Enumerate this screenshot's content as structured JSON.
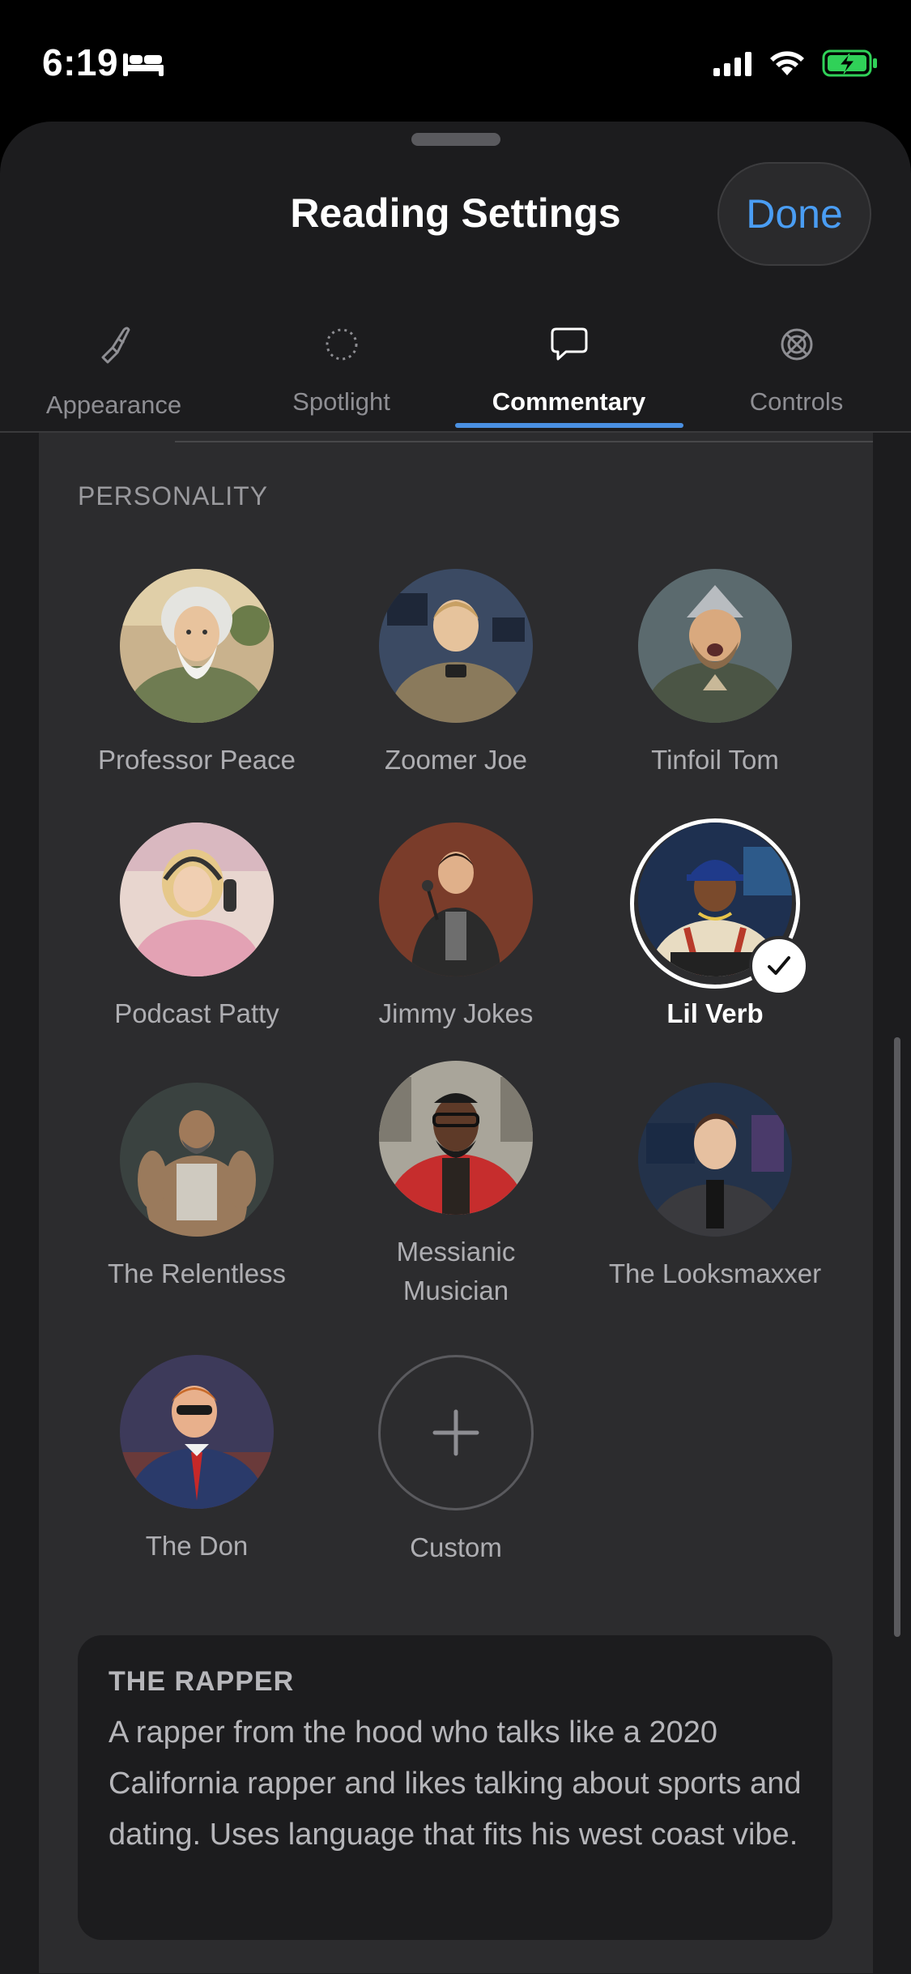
{
  "status_bar": {
    "time": "6:19",
    "icons": [
      "bed-icon",
      "cellular-signal-icon",
      "wifi-icon",
      "battery-charging-icon"
    ],
    "battery_color": "#30d158"
  },
  "sheet": {
    "title": "Reading Settings",
    "done_label": "Done",
    "accent_color": "#4a9df3"
  },
  "tabs": [
    {
      "label": "Appearance",
      "icon": "paintbrush-icon",
      "active": false
    },
    {
      "label": "Spotlight",
      "icon": "dotted-circle-icon",
      "active": false
    },
    {
      "label": "Commentary",
      "icon": "speech-bubble-icon",
      "active": true
    },
    {
      "label": "Controls",
      "icon": "crossed-circle-icon",
      "active": false
    }
  ],
  "personality": {
    "section_label": "PERSONALITY",
    "personas": [
      {
        "name": "Professor Peace",
        "icon": "wise-elder-avatar",
        "selected": false
      },
      {
        "name": "Zoomer Joe",
        "icon": "gamer-avatar",
        "selected": false
      },
      {
        "name": "Tinfoil Tom",
        "icon": "conspiracy-avatar",
        "selected": false
      },
      {
        "name": "Podcast Patty",
        "icon": "podcaster-avatar",
        "selected": false
      },
      {
        "name": "Jimmy Jokes",
        "icon": "comedian-avatar",
        "selected": false
      },
      {
        "name": "Lil Verb",
        "icon": "rapper-avatar",
        "selected": true
      },
      {
        "name": "The Relentless",
        "icon": "bodybuilder-avatar",
        "selected": false
      },
      {
        "name": "Messianic Musician",
        "icon": "musician-avatar",
        "selected": false
      },
      {
        "name": "The Looksmaxxer",
        "icon": "looksmaxxer-avatar",
        "selected": false
      },
      {
        "name": "The Don",
        "icon": "politician-avatar",
        "selected": false
      }
    ],
    "custom_label": "Custom"
  },
  "description": {
    "title": "THE RAPPER",
    "text": "A rapper from the hood who talks like a 2020 California rapper and likes talking about sports and dating. Uses language that fits his west coast vibe."
  }
}
